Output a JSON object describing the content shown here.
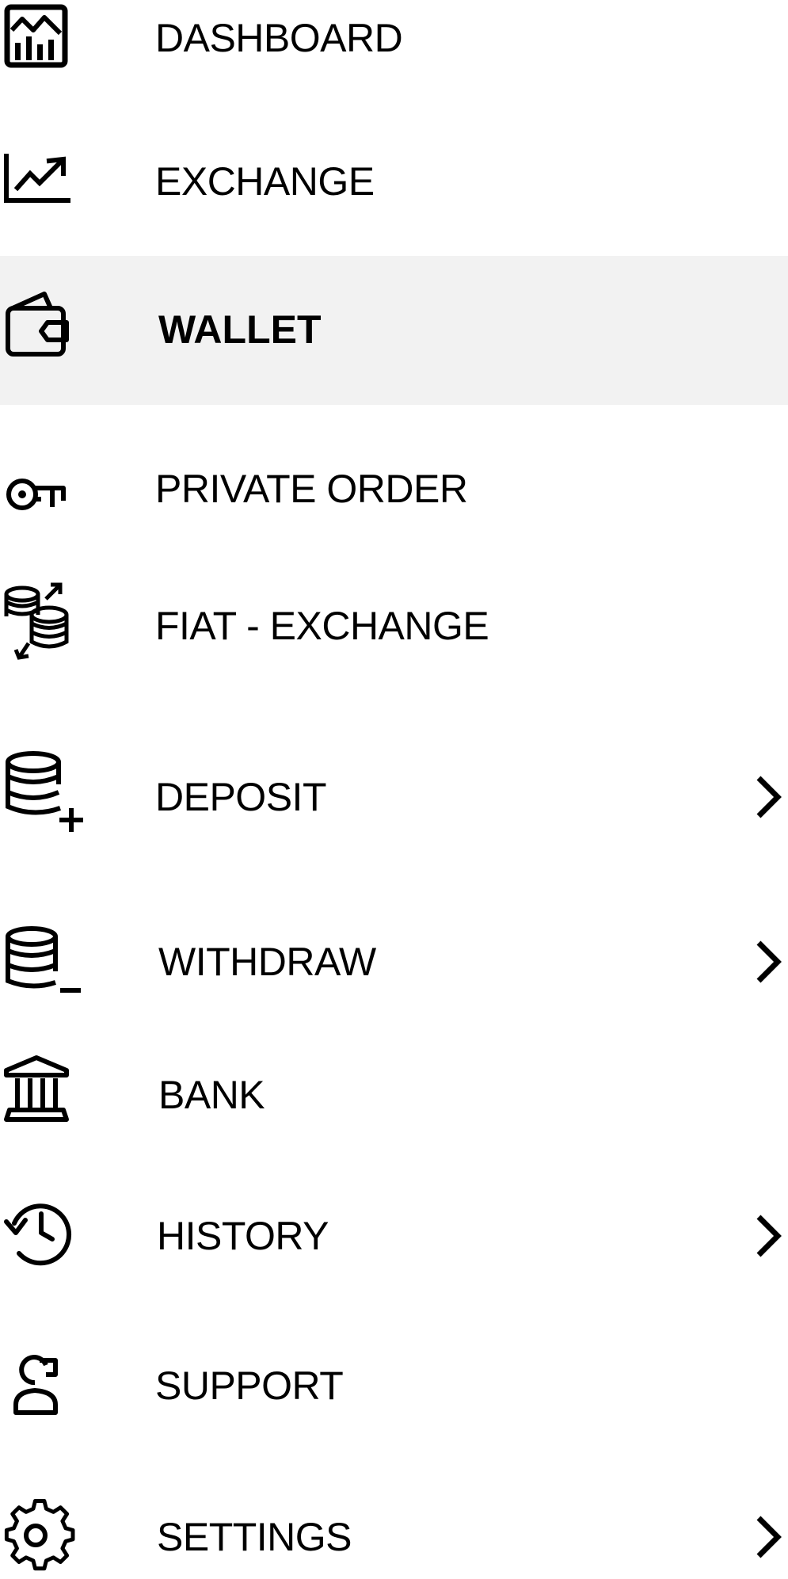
{
  "menu": {
    "active_item": "wallet",
    "highlight_color": "#f2f2f2",
    "items": [
      {
        "label": "DASHBOARD",
        "icon": "dashboard-chart-icon"
      },
      {
        "label": "EXCHANGE",
        "icon": "line-chart-icon"
      },
      {
        "label": "WALLET",
        "icon": "wallet-icon"
      },
      {
        "label": "PRIVATE ORDER",
        "icon": "key-icon"
      },
      {
        "label": "FIAT - EXCHANGE",
        "icon": "coin-exchange-icon"
      },
      {
        "label": "DEPOSIT",
        "icon": "database-plus-icon",
        "chevron": "chevron-right-icon"
      },
      {
        "label": "WITHDRAW",
        "icon": "database-minus-icon",
        "chevron": "chevron-right-icon"
      },
      {
        "label": "BANK",
        "icon": "bank-icon"
      },
      {
        "label": "HISTORY",
        "icon": "history-icon",
        "chevron": "chevron-right-icon"
      },
      {
        "label": "SUPPORT",
        "icon": "support-agent-icon"
      },
      {
        "label": "SETTINGS",
        "icon": "gear-icon",
        "chevron": "chevron-right-icon"
      }
    ]
  }
}
